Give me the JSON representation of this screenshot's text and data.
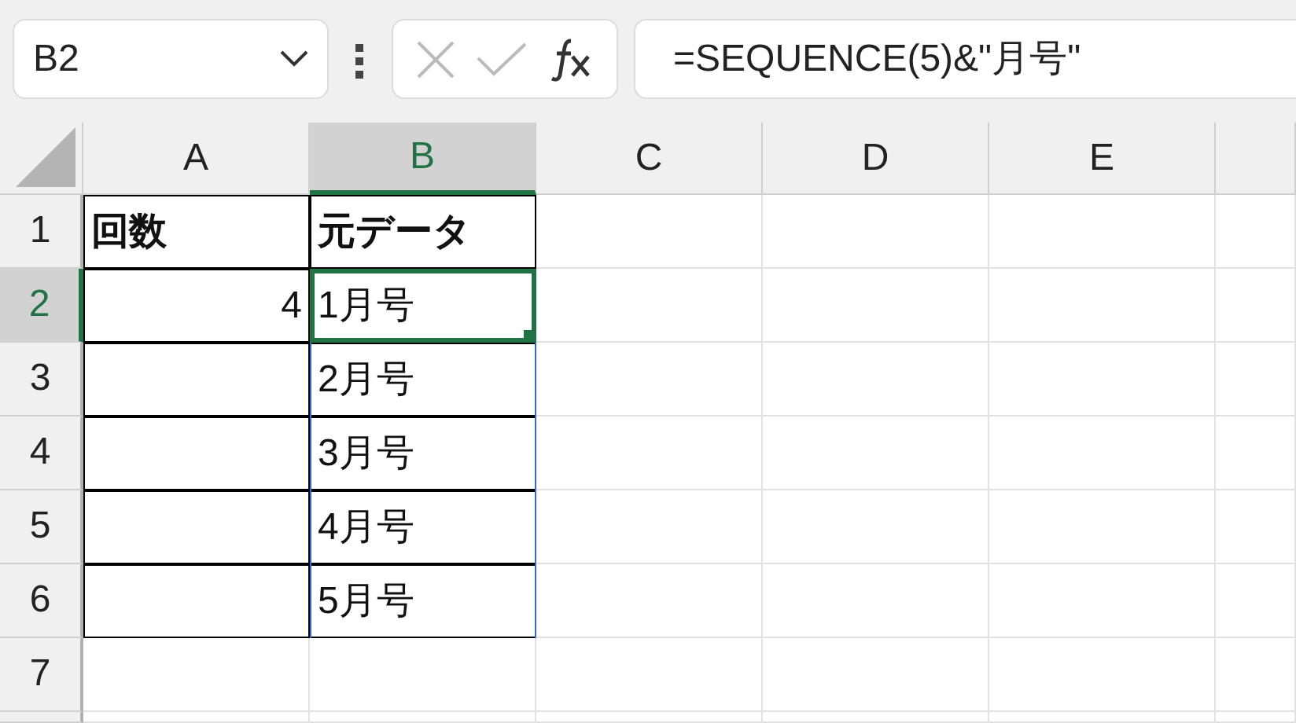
{
  "name_box": {
    "value": "B2"
  },
  "formula_bar": {
    "value": "=SEQUENCE(5)&\"月号\""
  },
  "columns": [
    {
      "label": "A",
      "selected": false
    },
    {
      "label": "B",
      "selected": true
    },
    {
      "label": "C",
      "selected": false
    },
    {
      "label": "D",
      "selected": false
    },
    {
      "label": "E",
      "selected": false
    }
  ],
  "rows": [
    {
      "label": "1",
      "selected": false,
      "cells": [
        {
          "text": "回数",
          "kind": "text",
          "bold": true,
          "bordered": true,
          "selected": false,
          "spill": false
        },
        {
          "text": "元データ",
          "kind": "text",
          "bold": true,
          "bordered": true,
          "selected": false,
          "spill": false
        }
      ]
    },
    {
      "label": "2",
      "selected": true,
      "cells": [
        {
          "text": "4",
          "kind": "number",
          "bold": false,
          "bordered": true,
          "selected": false,
          "spill": false
        },
        {
          "text": "1月号",
          "kind": "text",
          "bold": false,
          "bordered": true,
          "selected": true,
          "spill": true
        }
      ]
    },
    {
      "label": "3",
      "selected": false,
      "cells": [
        {
          "kind": "text",
          "bold": false,
          "bordered": true,
          "selected": false,
          "spill": false
        },
        {
          "text": "2月号",
          "kind": "text",
          "bold": false,
          "bordered": true,
          "selected": false,
          "spill": true
        }
      ]
    },
    {
      "label": "4",
      "selected": false,
      "cells": [
        {
          "kind": "text",
          "bold": false,
          "bordered": true,
          "selected": false,
          "spill": false
        },
        {
          "text": "3月号",
          "kind": "text",
          "bold": false,
          "bordered": true,
          "selected": false,
          "spill": true
        }
      ]
    },
    {
      "label": "5",
      "selected": false,
      "cells": [
        {
          "kind": "text",
          "bold": false,
          "bordered": true,
          "selected": false,
          "spill": false
        },
        {
          "text": "4月号",
          "kind": "text",
          "bold": false,
          "bordered": true,
          "selected": false,
          "spill": true
        }
      ]
    },
    {
      "label": "6",
      "selected": false,
      "cells": [
        {
          "kind": "text",
          "bold": false,
          "bordered": true,
          "selected": false,
          "spill": false
        },
        {
          "text": "5月号",
          "kind": "text",
          "bold": false,
          "bordered": true,
          "selected": false,
          "spill": true
        }
      ]
    },
    {
      "label": "7",
      "selected": false,
      "cells": []
    }
  ]
}
